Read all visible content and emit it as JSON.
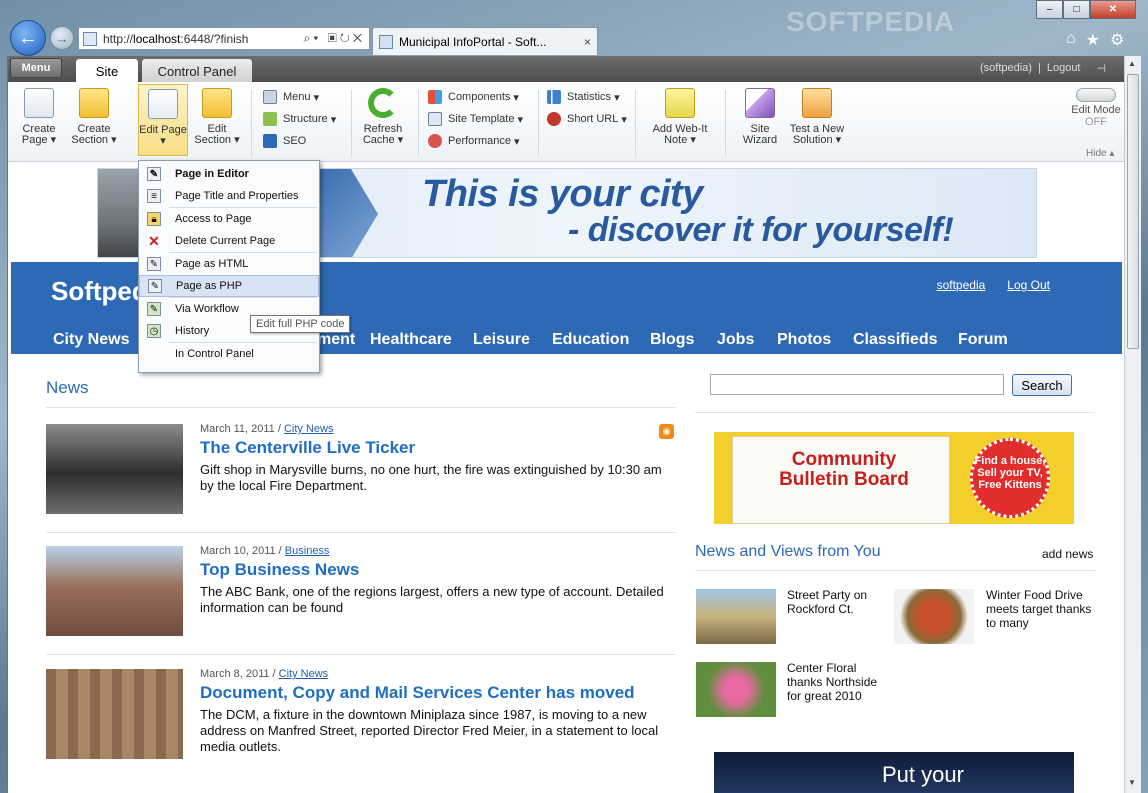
{
  "browser": {
    "address_prefix": "http://",
    "address_host": "localhost",
    "address_rest": ":6448/?finish",
    "tab_title": "Municipal InfoPortal - Soft...",
    "tab_close": "×",
    "watermark": "SOFTPEDIA"
  },
  "ribbon": {
    "menu_label": "Menu",
    "tabs": [
      "Site",
      "Control Panel"
    ],
    "user": "(softpedia)",
    "separator": "|",
    "logout": "Logout",
    "buttons": {
      "create_page": "Create Page",
      "create_section": "Create Section",
      "edit_page": "Edit Page",
      "edit_section": "Edit Section",
      "refresh_cache": "Refresh Cache",
      "add_note": "Add Web-It Note",
      "site_wizard": "Site Wizard",
      "test_solution": "Test a New Solution"
    },
    "col1": [
      "Menu",
      "Structure",
      "SEO"
    ],
    "col2": [
      "Components",
      "Site Template",
      "Performance"
    ],
    "col3": [
      "Statistics",
      "Short URL"
    ],
    "edit_mode_label": "Edit Mode",
    "edit_mode_state": "OFF",
    "hide_label": "Hide"
  },
  "dropdown": {
    "items": [
      "Page in Editor",
      "Page Title and Properties",
      "Access to Page",
      "Delete Current Page",
      "Page as HTML",
      "Page as PHP",
      "Via Workflow",
      "History",
      "In Control Panel"
    ],
    "tooltip": "Edit full PHP code"
  },
  "banner": {
    "line1": "This is your city",
    "line2": "- discover it for yourself!"
  },
  "header": {
    "site_name": "Softpedia",
    "user_link": "softpedia",
    "logout_link": "Log Out",
    "nav": [
      "City News",
      "ment",
      "Healthcare",
      "Leisure",
      "Education",
      "Blogs",
      "Jobs",
      "Photos",
      "Classifieds",
      "Forum"
    ]
  },
  "news": {
    "heading": "News",
    "articles": [
      {
        "date": "March 11, 2011 / ",
        "category": "City News",
        "title": "The Centerville Live Ticker",
        "text": "Gift shop in Marysville burns, no one hurt, the fire was extinguished by 10:30 am by the local Fire Department."
      },
      {
        "date": "March 10, 2011 / ",
        "category": "Business",
        "title": "Top Business News",
        "text": "The ABC Bank, one of the regions largest, offers a new type of account.  Detailed information can be found"
      },
      {
        "date": "March 8, 2011 / ",
        "category": "City News",
        "title": "Document, Copy and Mail Services Center has moved",
        "text": "The DCM, a fixture in the downtown Miniplaza since 1987, is moving to a new address on Manfred Street, reported Director Fred Meier, in a statement to local media outlets."
      }
    ]
  },
  "sidebar": {
    "search_button": "Search",
    "bulletin_title": "Community Bulletin Board",
    "bulletin_badge": "Find a house, Sell your TV, Free Kittens",
    "views_heading": "News and Views from You",
    "add_news": "add news",
    "views": [
      "Street Party on Rockford Ct.",
      "Winter Food Drive meets target thanks to many",
      "Center Floral thanks Northside for great 2010"
    ],
    "ad_text": "Put your"
  }
}
